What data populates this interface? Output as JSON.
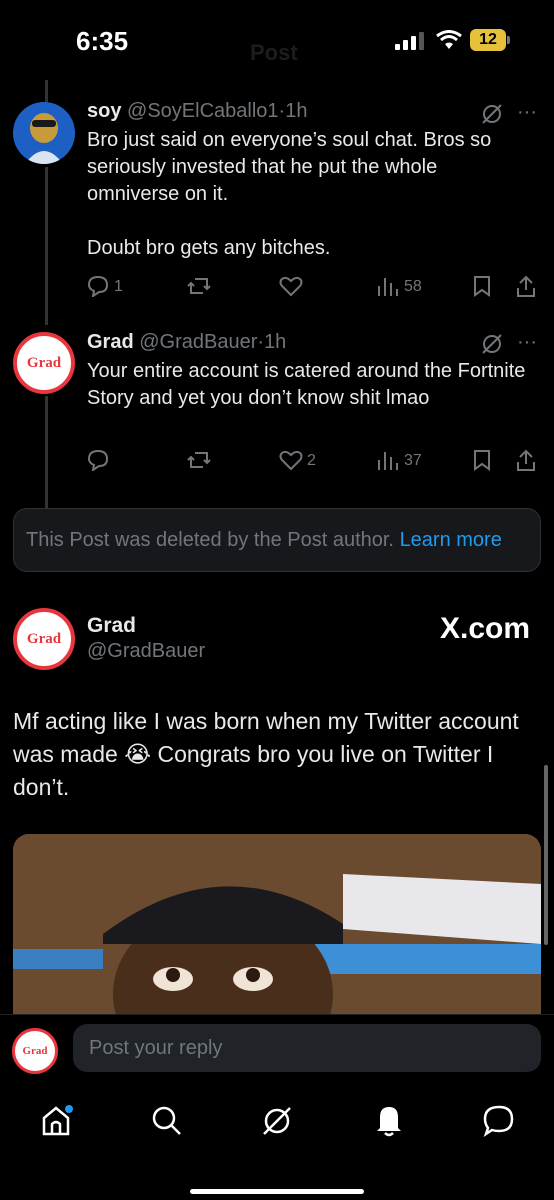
{
  "status": {
    "time": "6:35",
    "battery": "12",
    "faded_title": "Post"
  },
  "reply1": {
    "name": "soy",
    "handle": "@SoyElCaballo1",
    "time": "1h",
    "text": "Bro just said on everyone’s soul chat. Bros so seriously invested that he put the whole omniverse on it.\n\nDoubt bro gets any bitches.",
    "replies": "1",
    "views": "58"
  },
  "reply2": {
    "name": "Grad",
    "avatar_text": "Grad",
    "handle": "@GradBauer",
    "time": "1h",
    "text": "Your entire account is catered around the Fortnite Story and yet you don’t know shit lmao",
    "likes": "2",
    "views": "37"
  },
  "deleted": {
    "text": "This Post was deleted by the Post author.",
    "link": "Learn more"
  },
  "quote": {
    "name": "Grad",
    "handle": "@GradBauer",
    "avatar_text": "Grad",
    "brand": "X.com",
    "text": "Mf acting like I was born when my Twitter account was made 😭 Congrats bro you live on Twitter I don’t."
  },
  "reply_bar": {
    "avatar_text": "Grad",
    "placeholder": "Post your reply"
  },
  "colors": {
    "accent": "#1d9bf0",
    "grad_red": "#e8363d",
    "muted": "#71767b"
  }
}
